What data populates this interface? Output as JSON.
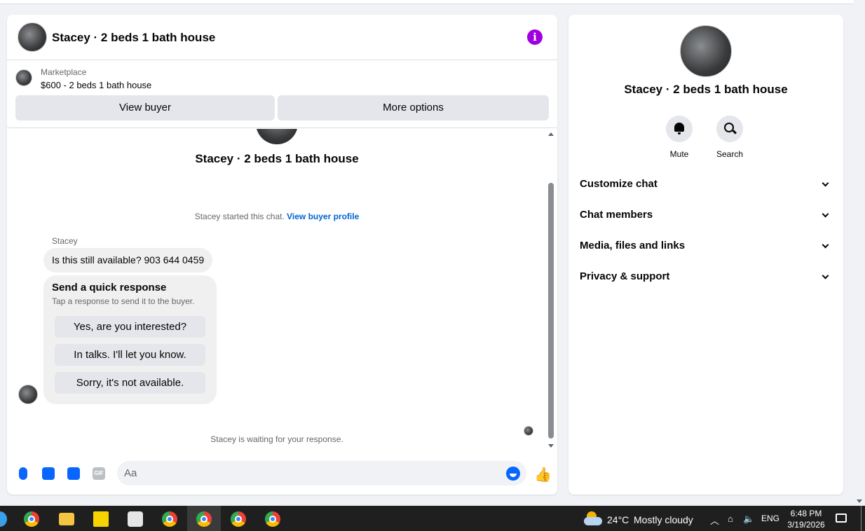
{
  "header": {
    "title": "Stacey · 2 beds 1 bath house",
    "info_icon": "i"
  },
  "marketplace": {
    "label": "Marketplace",
    "listing": "$600 - 2 beds 1 bath house",
    "view_buyer": "View buyer",
    "more_options": "More options"
  },
  "thread": {
    "title": "Stacey · 2 beds 1 bath house",
    "started_text": "Stacey started this chat.",
    "started_link": "View buyer profile",
    "sender": "Stacey",
    "message": "Is this still available? 903 644 0459",
    "quick_title": "Send a quick response",
    "quick_subtitle": "Tap a response to send it to the buyer.",
    "quick_responses": [
      "Yes, are you interested?",
      "In talks. I'll let you know.",
      "Sorry, it's not available."
    ],
    "waiting": "Stacey is waiting for your response."
  },
  "composer": {
    "placeholder": "Aa",
    "gif_label": "GIF",
    "accent": "#0866ff"
  },
  "info_panel": {
    "title": "Stacey · 2 beds 1 bath house",
    "mute": "Mute",
    "search": "Search",
    "sections": [
      "Customize chat",
      "Chat members",
      "Media, files and links",
      "Privacy & support"
    ]
  },
  "taskbar": {
    "weather": "24°C",
    "weather_desc": "Mostly cloudy",
    "lang": "ENG",
    "time": "6:48 PM",
    "date": "3/19/2026"
  }
}
